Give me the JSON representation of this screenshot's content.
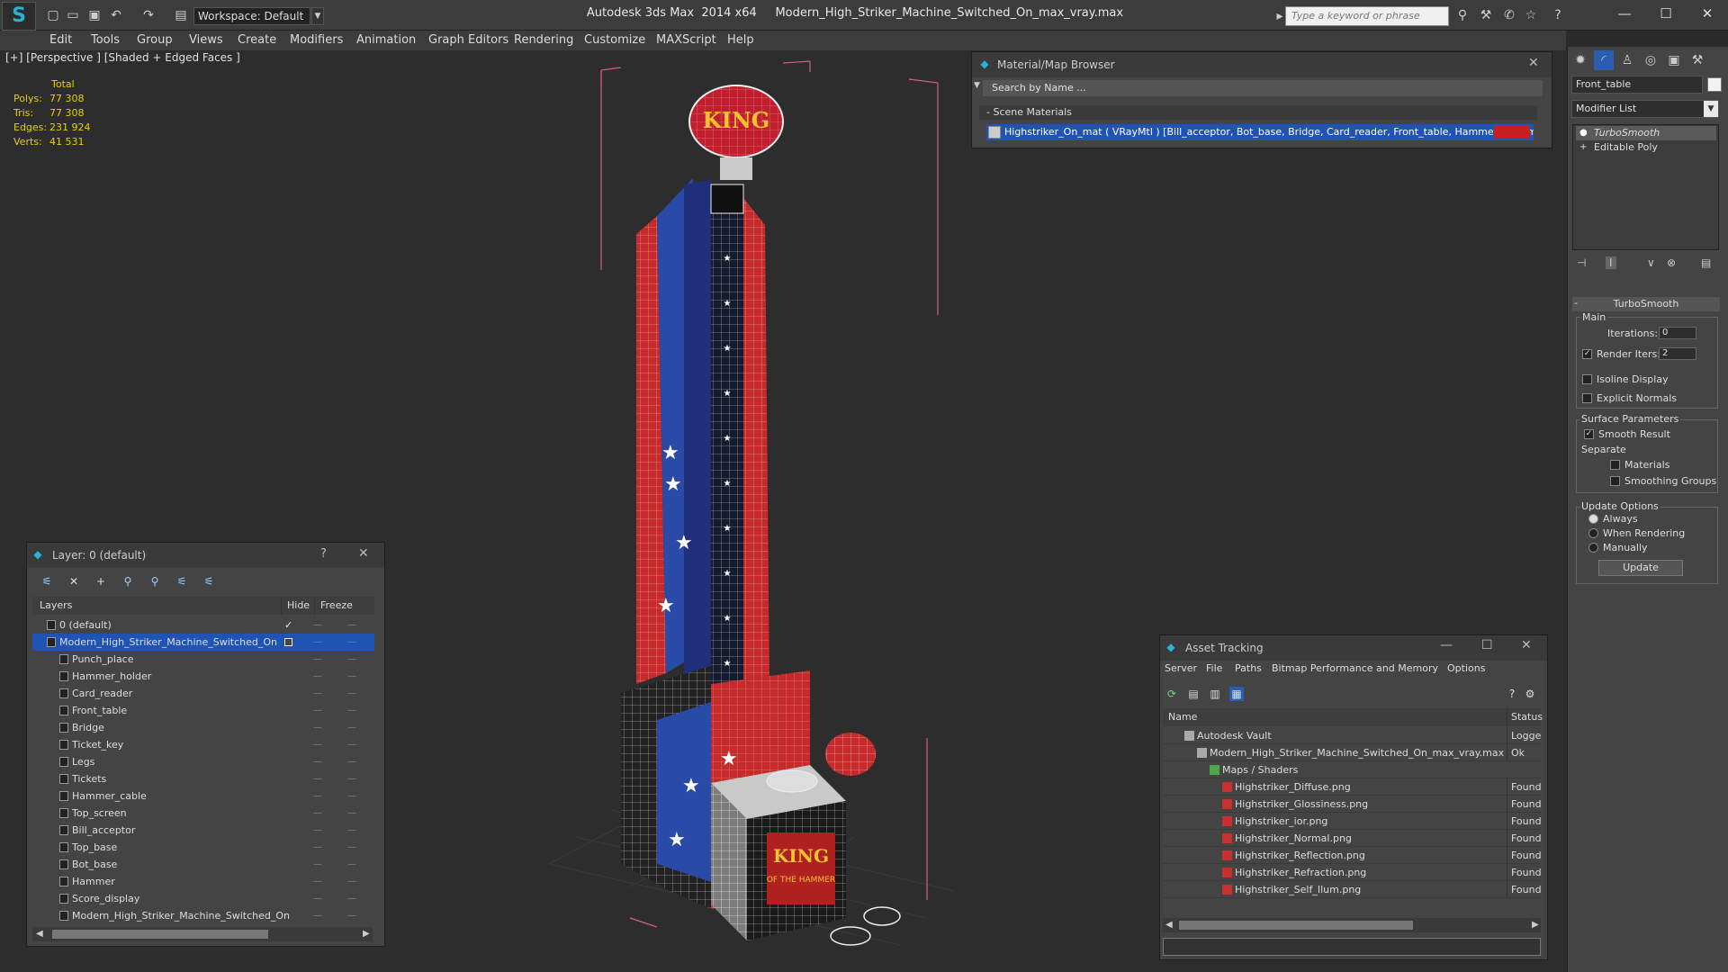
{
  "app": {
    "title": "Autodesk 3ds Max  2014 x64     Modern_High_Striker_Machine_Switched_On_max_vray.max",
    "workspace": "Workspace: Default",
    "search_placeholder": "Type a keyword or phrase"
  },
  "menu": [
    "Edit",
    "Tools",
    "Group",
    "Views",
    "Create",
    "Modifiers",
    "Animation",
    "Graph Editors",
    "Rendering",
    "Customize",
    "MAXScript",
    "Help"
  ],
  "viewport": {
    "label": "[+] [Perspective ] [Shaded + Edged Faces ]",
    "stats": {
      "header": "Total",
      "rows": [
        {
          "label": "Polys:",
          "value": "77 308"
        },
        {
          "label": "Tris:",
          "value": "77 308"
        },
        {
          "label": "Edges:",
          "value": "231 924"
        },
        {
          "label": "Verts:",
          "value": "41 531"
        }
      ]
    },
    "sign_text": "KING",
    "box_text_1": "KING",
    "box_text_2": "OF THE HAMMER"
  },
  "material_browser": {
    "title": "Material/Map Browser",
    "search": "Search by Name ...",
    "section": "- Scene Materials",
    "item": "Highstriker_On_mat  ( VRayMtl ) [Bill_acceptor, Bot_base, Bridge, Card_reader, Front_table, Hammer, Hammer_c..."
  },
  "command_panel": {
    "object_name": "Front_table",
    "modifier_list": "Modifier List",
    "stack": [
      "TurboSmooth",
      "Editable Poly"
    ],
    "rollout": "TurboSmooth",
    "main_label": "Main",
    "iterations_label": "Iterations:",
    "iterations_value": "0",
    "render_iters_label": "Render Iters:",
    "render_iters_value": "2",
    "isoline": "Isoline Display",
    "explicit": "Explicit Normals",
    "surface_label": "Surface Parameters",
    "smooth_result": "Smooth Result",
    "separate": "Separate",
    "materials": "Materials",
    "smoothing_groups": "Smoothing Groups",
    "update_options": "Update Options",
    "always": "Always",
    "when_rendering": "When Rendering",
    "manually": "Manually",
    "update_button": "Update"
  },
  "layer_explorer": {
    "title": "Layer: 0 (default)",
    "help": "?",
    "col_layers": "Layers",
    "col_hide": "Hide",
    "col_freeze": "Freeze",
    "rows": [
      {
        "name": "0 (default)",
        "indent": 1
      },
      {
        "name": "Modern_High_Striker_Machine_Switched_On",
        "indent": 1,
        "selected": true
      },
      {
        "name": "Punch_place",
        "indent": 2
      },
      {
        "name": "Hammer_holder",
        "indent": 2
      },
      {
        "name": "Card_reader",
        "indent": 2
      },
      {
        "name": "Front_table",
        "indent": 2
      },
      {
        "name": "Bridge",
        "indent": 2
      },
      {
        "name": "Ticket_key",
        "indent": 2
      },
      {
        "name": "Legs",
        "indent": 2
      },
      {
        "name": "Tickets",
        "indent": 2
      },
      {
        "name": "Hammer_cable",
        "indent": 2
      },
      {
        "name": "Top_screen",
        "indent": 2
      },
      {
        "name": "Bill_acceptor",
        "indent": 2
      },
      {
        "name": "Top_base",
        "indent": 2
      },
      {
        "name": "Bot_base",
        "indent": 2
      },
      {
        "name": "Hammer",
        "indent": 2
      },
      {
        "name": "Score_display",
        "indent": 2
      },
      {
        "name": "Modern_High_Striker_Machine_Switched_On",
        "indent": 2
      }
    ]
  },
  "asset_tracking": {
    "title": "Asset Tracking",
    "menu": [
      "Server",
      "File",
      "Paths",
      "Bitmap Performance and Memory",
      "Options"
    ],
    "col_name": "Name",
    "col_status": "Status",
    "rows": [
      {
        "name": "Autodesk Vault",
        "status": "Logged",
        "indent": 1
      },
      {
        "name": "Modern_High_Striker_Machine_Switched_On_max_vray.max",
        "status": "Ok",
        "indent": 2
      },
      {
        "name": "Maps / Shaders",
        "status": "",
        "indent": 3
      },
      {
        "name": "Highstriker_Diffuse.png",
        "status": "Found",
        "indent": 4
      },
      {
        "name": "Highstriker_Glossiness.png",
        "status": "Found",
        "indent": 4
      },
      {
        "name": "Highstriker_ior.png",
        "status": "Found",
        "indent": 4
      },
      {
        "name": "Highstriker_Normal.png",
        "status": "Found",
        "indent": 4
      },
      {
        "name": "Highstriker_Reflection.png",
        "status": "Found",
        "indent": 4
      },
      {
        "name": "Highstriker_Refraction.png",
        "status": "Found",
        "indent": 4
      },
      {
        "name": "Highstriker_Self_Ilum.png",
        "status": "Found",
        "indent": 4
      }
    ]
  },
  "colors": {
    "selection": "#1f54b4",
    "stats": "#e8d000",
    "bounding_box": "#d0607a",
    "model_red": "#c62a2a",
    "model_blue": "#2a4aa8"
  }
}
